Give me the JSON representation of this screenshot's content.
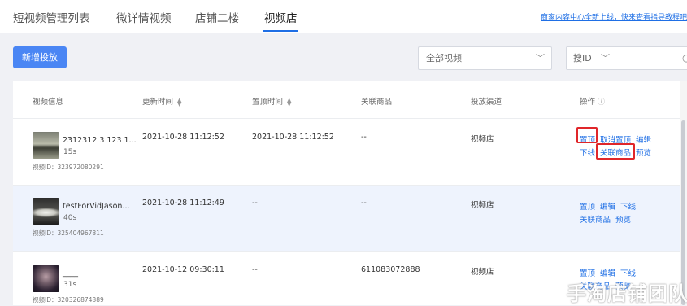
{
  "tabs": [
    {
      "label": "短视频管理列表"
    },
    {
      "label": "微详情视频"
    },
    {
      "label": "店铺二楼"
    },
    {
      "label": "视频店"
    }
  ],
  "active_tab": "视频店",
  "notice": "商家内容中心全新上线，快来查看指导教程吧",
  "toolbar": {
    "add_button": "新增投放",
    "video_filter": "全部视频",
    "search_type": "搜ID"
  },
  "table": {
    "headers": {
      "video_info": "视频信息",
      "update_time": "更新时间",
      "pin_time": "置顶时间",
      "related_product": "关联商品",
      "channel": "投放渠道",
      "actions": "操作"
    },
    "rows": [
      {
        "title": "2312312 3 123 1...",
        "duration": "15s",
        "video_id": "视频ID：323972080291",
        "update_time": "2021-10-28 11:12:52",
        "pin_time": "2021-10-28 11:12:52",
        "product": "--",
        "channel": "视频店",
        "actions": [
          "置顶",
          "取消置顶",
          "编辑",
          "下线",
          "关联商品",
          "预览"
        ]
      },
      {
        "title": "testForVidJason...",
        "duration": "40s",
        "video_id": "视频ID：325404967811",
        "update_time": "2021-10-28 11:12:49",
        "pin_time": "--",
        "product": "--",
        "channel": "视频店",
        "actions": [
          "置顶",
          "编辑",
          "下线",
          "关联商品",
          "预览"
        ]
      },
      {
        "title": "____",
        "duration": "31s",
        "video_id": "视频ID：320326874889",
        "update_time": "2021-10-12 09:30:11",
        "pin_time": "--",
        "product": "611083072888",
        "channel": "视频店",
        "actions": [
          "置顶",
          "编辑",
          "下线",
          "关联商品",
          "预览"
        ]
      }
    ]
  },
  "watermark": "手淘店铺团队",
  "colors": {
    "accent": "#1f6fe5",
    "button": "#4a86f4",
    "highlight_row": "#eef3fd",
    "annotation": "#e0262a"
  }
}
